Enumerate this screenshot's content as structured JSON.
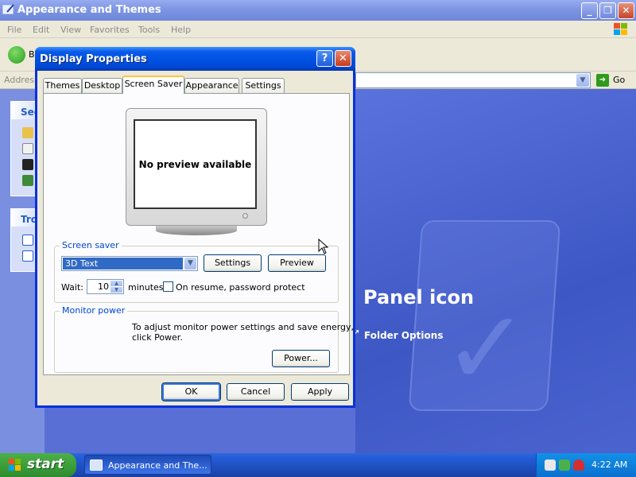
{
  "explorer": {
    "title": "Appearance and Themes",
    "menu": [
      "File",
      "Edit",
      "View",
      "Favorites",
      "Tools",
      "Help"
    ],
    "toolbar": {
      "back_label": "B"
    },
    "address": {
      "label": "Address",
      "go_label": "Go"
    },
    "sidebar": {
      "see_also_header": "See",
      "troubleshooters_header": "Tro"
    },
    "main": {
      "panel_icon_text": "Panel icon",
      "folder_options": "Folder Options"
    }
  },
  "dialog": {
    "title": "Display Properties",
    "help_symbol": "?",
    "close_symbol": "✕",
    "tabs": [
      "Themes",
      "Desktop",
      "Screen Saver",
      "Appearance",
      "Settings"
    ],
    "active_tab": "Screen Saver",
    "preview_text": "No preview available",
    "screen_saver": {
      "group_label": "Screen saver",
      "selected": "3D Text",
      "settings_button": "Settings",
      "preview_button": "Preview",
      "wait_label": "Wait:",
      "wait_value": "10",
      "minutes_label": "minutes",
      "password_label": "On resume, password protect"
    },
    "monitor_power": {
      "group_label": "Monitor power",
      "description_line1": "To adjust monitor power settings and save energy,",
      "description_line2": "click Power.",
      "power_button": "Power..."
    },
    "buttons": {
      "ok": "OK",
      "cancel": "Cancel",
      "apply": "Apply"
    }
  },
  "taskbar": {
    "start_label": "start",
    "task_item": "Appearance and The...",
    "clock": "4:22 AM"
  },
  "colors": {
    "dialog_title": "#0053e4",
    "start_green": "#3c9f3a",
    "taskbar_blue": "#245edb",
    "group_label": "#0046d5"
  }
}
